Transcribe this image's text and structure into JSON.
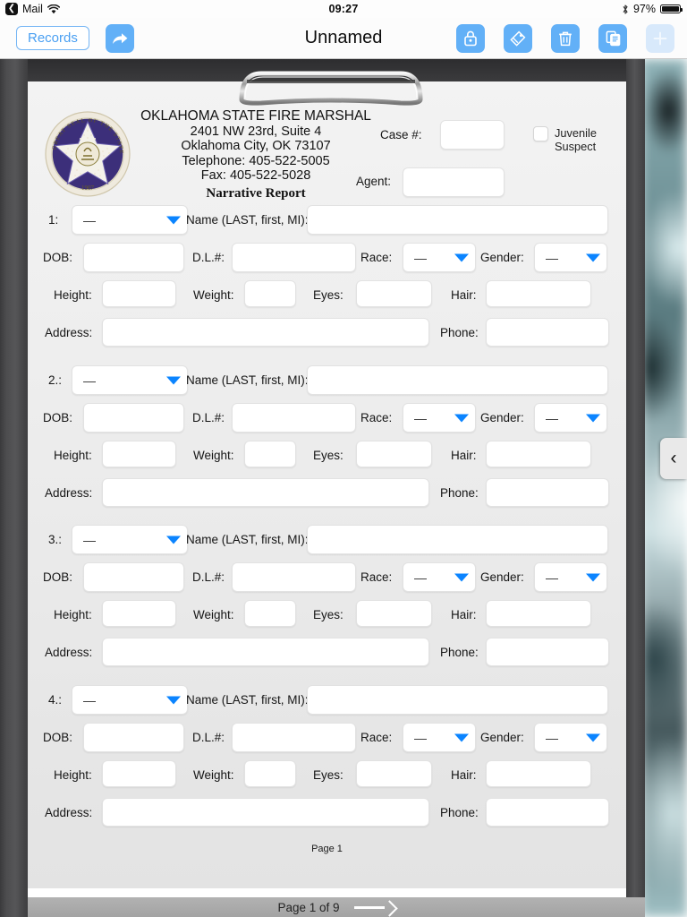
{
  "status_bar": {
    "back_app": "Mail",
    "wifi_icon": "wifi-icon",
    "time": "09:27",
    "bluetooth_icon": "bluetooth-icon",
    "battery_percent": "97%"
  },
  "nav_bar": {
    "back_button": "Records",
    "share_icon": "share-arrow-icon",
    "title": "Unnamed",
    "actions": [
      {
        "name": "lock-icon",
        "label": "Lock",
        "disabled": false
      },
      {
        "name": "tag-icon",
        "label": "Tag",
        "disabled": false
      },
      {
        "name": "trash-icon",
        "label": "Delete",
        "disabled": false
      },
      {
        "name": "duplicate-icon",
        "label": "Duplicate",
        "disabled": false
      },
      {
        "name": "plus-icon",
        "label": "Add",
        "disabled": true
      }
    ]
  },
  "form": {
    "org_name": "OKLAHOMA STATE FIRE MARSHAL",
    "address_line1": "2401 NW 23rd, Suite 4",
    "address_line2": "Oklahoma City, OK  73107",
    "telephone": "Telephone: 405-522-5005",
    "fax": "Fax:  405-522-5028",
    "report_title": "Narrative Report",
    "seal_icon": "oklahoma-state-seal-icon",
    "case_label": "Case #:",
    "case_value": "",
    "agent_label": "Agent:",
    "agent_value": "",
    "juvenile_label_line1": "Juvenile",
    "juvenile_label_line2": "Suspect",
    "juvenile_checked": false,
    "name_label": "Name (LAST, first, MI):",
    "dob_label": "DOB:",
    "dl_label": "D.L.#:",
    "race_label": "Race:",
    "gender_label": "Gender:",
    "height_label": "Height:",
    "weight_label": "Weight:",
    "eyes_label": "Eyes:",
    "hair_label": "Hair:",
    "address_label": "Address:",
    "phone_label": "Phone:",
    "dropdown_placeholder": "—",
    "persons": [
      {
        "index_label": "1:",
        "type": "—",
        "name": "",
        "dob": "",
        "dl": "",
        "race": "—",
        "gender": "—",
        "height": "",
        "weight": "",
        "eyes": "",
        "hair": "",
        "address": "",
        "phone": ""
      },
      {
        "index_label": "2.:",
        "type": "—",
        "name": "",
        "dob": "",
        "dl": "",
        "race": "—",
        "gender": "—",
        "height": "",
        "weight": "",
        "eyes": "",
        "hair": "",
        "address": "",
        "phone": ""
      },
      {
        "index_label": "3.:",
        "type": "—",
        "name": "",
        "dob": "",
        "dl": "",
        "race": "—",
        "gender": "—",
        "height": "",
        "weight": "",
        "eyes": "",
        "hair": "",
        "address": "",
        "phone": ""
      },
      {
        "index_label": "4.:",
        "type": "—",
        "name": "",
        "dob": "",
        "dl": "",
        "race": "—",
        "gender": "—",
        "height": "",
        "weight": "",
        "eyes": "",
        "hair": "",
        "address": "",
        "phone": ""
      }
    ],
    "page_footnote": "Page 1"
  },
  "bottom_bar": {
    "page_indicator": "Page 1 of 9",
    "next_icon": "right-arrow-icon"
  },
  "side_tab": {
    "icon": "chevron-left-icon",
    "glyph": "‹"
  },
  "colors": {
    "accent": "#0b84ff",
    "toolbar_icon": "#62b0f7",
    "records_border": "#74b5f5"
  }
}
